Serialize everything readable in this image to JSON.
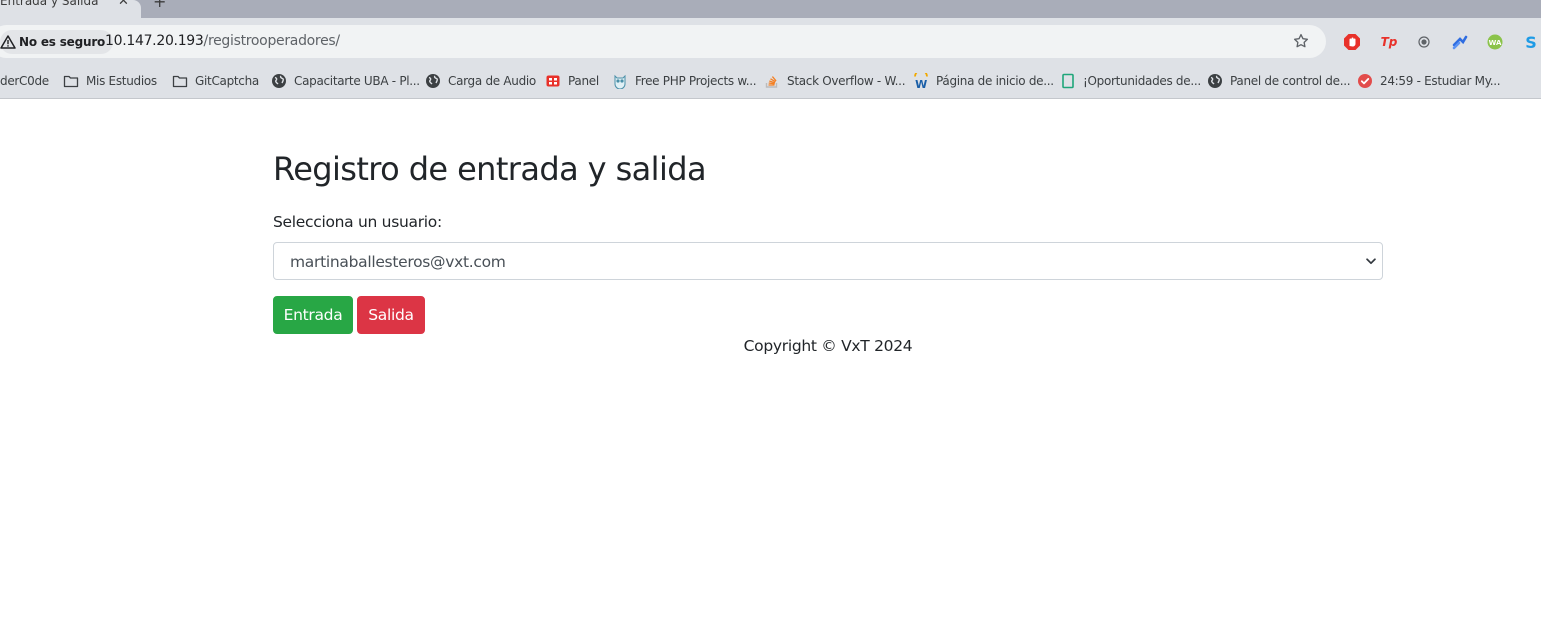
{
  "browser": {
    "tab": {
      "title": "Entrada y Salida",
      "close_glyph": "✕"
    },
    "new_tab_glyph": "+",
    "security_label": "No es seguro",
    "url_host": "10.147.20.193",
    "url_path": "/registrooperadores/",
    "extensions": [
      {
        "icon": "adblock-icon",
        "color": "#e8312a"
      },
      {
        "icon": "tp-icon",
        "label": "Tp",
        "color": "#e8312a"
      },
      {
        "icon": "record-icon",
        "color": "#5f6368"
      },
      {
        "icon": "arrow-extension-icon",
        "color": "#2f6de1"
      },
      {
        "icon": "wa-icon",
        "label": "WA",
        "color": "#8bc34a"
      },
      {
        "icon": "s-extension-icon",
        "label": "S",
        "color": "#1e9be6"
      }
    ]
  },
  "bookmarks": [
    {
      "label": "derC0de",
      "icon": "none"
    },
    {
      "label": "Mis Estudios",
      "icon": "folder-icon"
    },
    {
      "label": "GitCaptcha",
      "icon": "folder-icon"
    },
    {
      "label": "Capacitarte UBA - Pl...",
      "icon": "globe-icon"
    },
    {
      "label": "Carga de Audio",
      "icon": "globe-icon"
    },
    {
      "label": "Panel",
      "icon": "panel-icon",
      "color": "#e8312a"
    },
    {
      "label": "Free PHP Projects w...",
      "icon": "owl-icon"
    },
    {
      "label": "Stack Overflow - W...",
      "icon": "stackoverflow-icon",
      "color": "#f48024"
    },
    {
      "label": "Página de inicio de...",
      "icon": "workana-icon",
      "color": "#f2a900"
    },
    {
      "label": "¡Oportunidades de...",
      "icon": "doc-icon",
      "color": "#1fa67a"
    },
    {
      "label": "Panel de control de...",
      "icon": "globe-icon"
    },
    {
      "label": "24:59 - Estudiar My...",
      "icon": "check-icon",
      "color": "#e24c4b"
    }
  ],
  "page": {
    "title": "Registro de entrada y salida",
    "select_label": "Selecciona un usuario:",
    "selected_user": "martinaballesteros@vxt.com",
    "entrada_label": "Entrada",
    "salida_label": "Salida",
    "footer": "Copyright © VxT 2024",
    "colors": {
      "entrada": "#28a745",
      "salida": "#dc3545"
    }
  }
}
